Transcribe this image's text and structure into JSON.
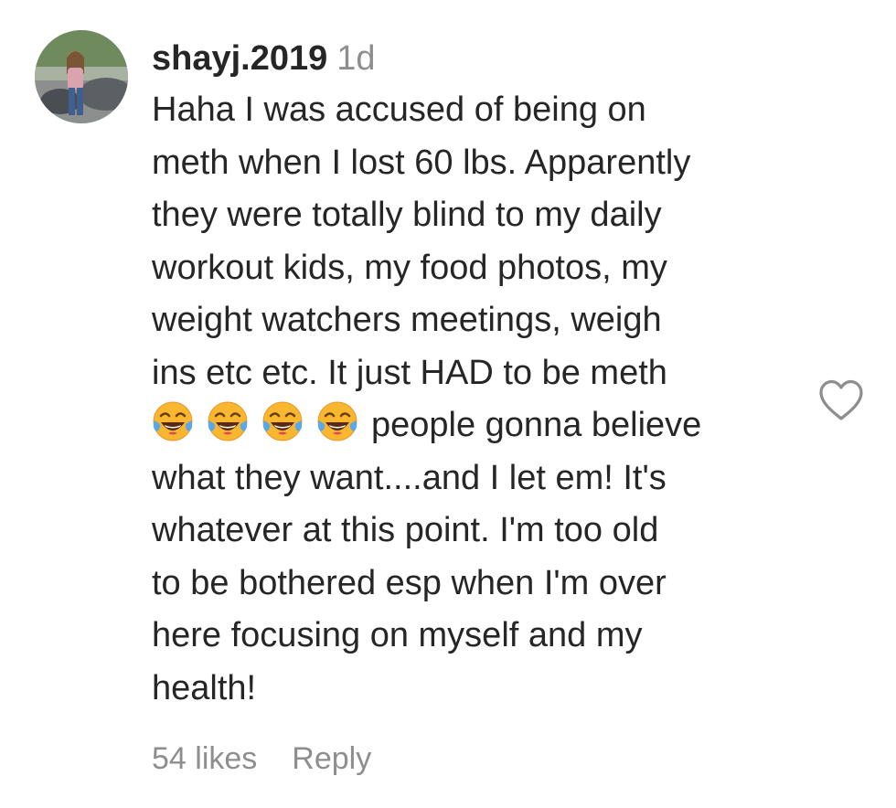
{
  "comment": {
    "username": "shayj.2019",
    "time": "1d",
    "text_lines": [
      "Haha I was accused of being on",
      "meth when I lost 60 lbs. Apparently",
      "they were totally blind to my daily",
      "workout kids, my food photos, my",
      "weight watchers meetings, weigh",
      "ins etc etc. It just HAD to be meth",
      "people gonna believe",
      "what they want....and I let em! It's",
      "whatever at this point. I'm too old",
      "to be bothered esp when I'm over",
      "here focusing on myself and my",
      "health!"
    ],
    "emoji_name": "face-with-tears-of-joy-emoji",
    "emoji_count": 4,
    "likes_label": "54 likes",
    "reply_label": "Reply"
  },
  "icons": {
    "like": "heart-outline-icon"
  },
  "colors": {
    "text": "#262626",
    "secondary": "#8e8e8e",
    "emoji_face": "#f9b62f"
  }
}
